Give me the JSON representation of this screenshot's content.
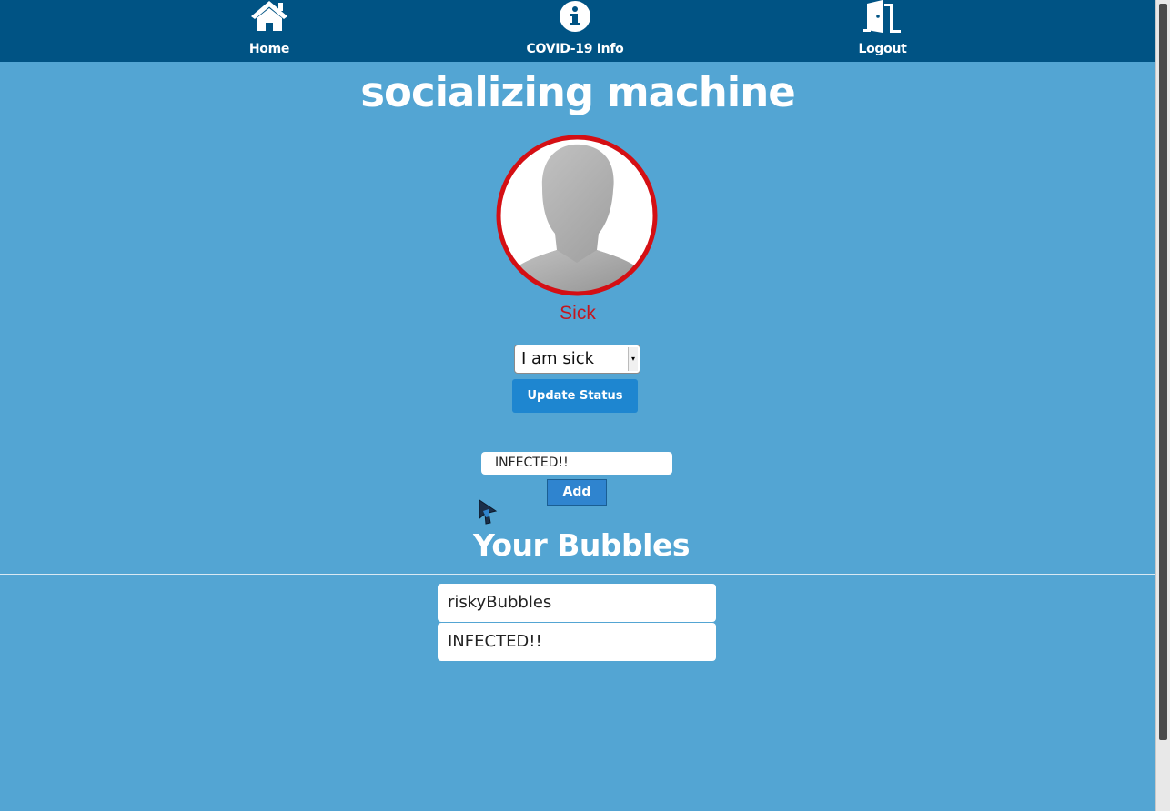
{
  "nav": {
    "items": [
      {
        "label": "Home",
        "icon": "home-icon"
      },
      {
        "label": "COVID-19 Info",
        "icon": "info-icon"
      },
      {
        "label": "Logout",
        "icon": "door-icon"
      }
    ]
  },
  "header": {
    "title": "socializing machine"
  },
  "profile": {
    "status_text": "Sick",
    "status_color": "#c5161d",
    "ring_color": "#d40f14"
  },
  "status_form": {
    "selected": "I am sick",
    "update_label": "Update Status"
  },
  "bubble_form": {
    "input_value": "INFECTED!!",
    "add_label": "Add"
  },
  "bubbles": {
    "title": "Your Bubbles",
    "items": [
      "riskyBubbles",
      "INFECTED!!"
    ]
  },
  "colors": {
    "navbar": "#005384",
    "background": "#53a5d3",
    "button": "#1e86d0"
  }
}
